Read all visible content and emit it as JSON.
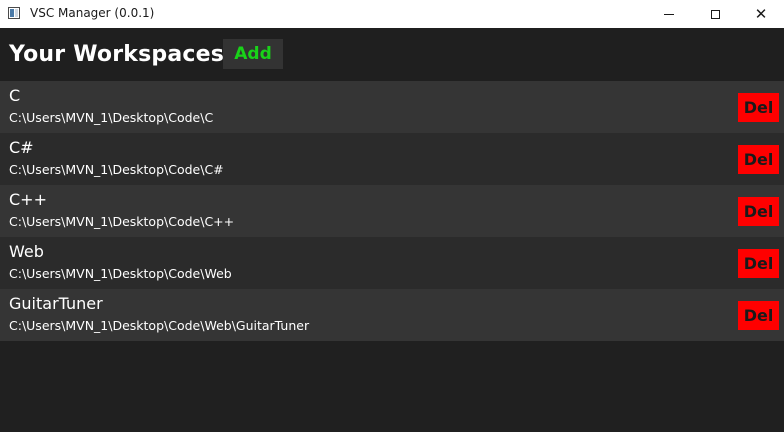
{
  "window": {
    "title": "VSC Manager (0.0.1)",
    "icon": "app-window-icon",
    "controls": {
      "minimize": "minimize-icon",
      "maximize": "maximize-icon",
      "close_glyph": "✕"
    }
  },
  "header": {
    "title": "Your Workspaces",
    "add_label": "Add"
  },
  "colors": {
    "background": "#202020",
    "row_odd": "#353535",
    "row_even": "#2b2b2b",
    "add_text": "#19d219",
    "delete_bg": "#ff0000"
  },
  "workspaces": [
    {
      "name": "C",
      "path": "C:\\Users\\MVN_1\\Desktop\\Code\\C",
      "delete_label": "Del"
    },
    {
      "name": "C#",
      "path": "C:\\Users\\MVN_1\\Desktop\\Code\\C#",
      "delete_label": "Del"
    },
    {
      "name": "C++",
      "path": "C:\\Users\\MVN_1\\Desktop\\Code\\C++",
      "delete_label": "Del"
    },
    {
      "name": "Web",
      "path": "C:\\Users\\MVN_1\\Desktop\\Code\\Web",
      "delete_label": "Del"
    },
    {
      "name": "GuitarTuner",
      "path": "C:\\Users\\MVN_1\\Desktop\\Code\\Web\\GuitarTuner",
      "delete_label": "Del"
    }
  ]
}
